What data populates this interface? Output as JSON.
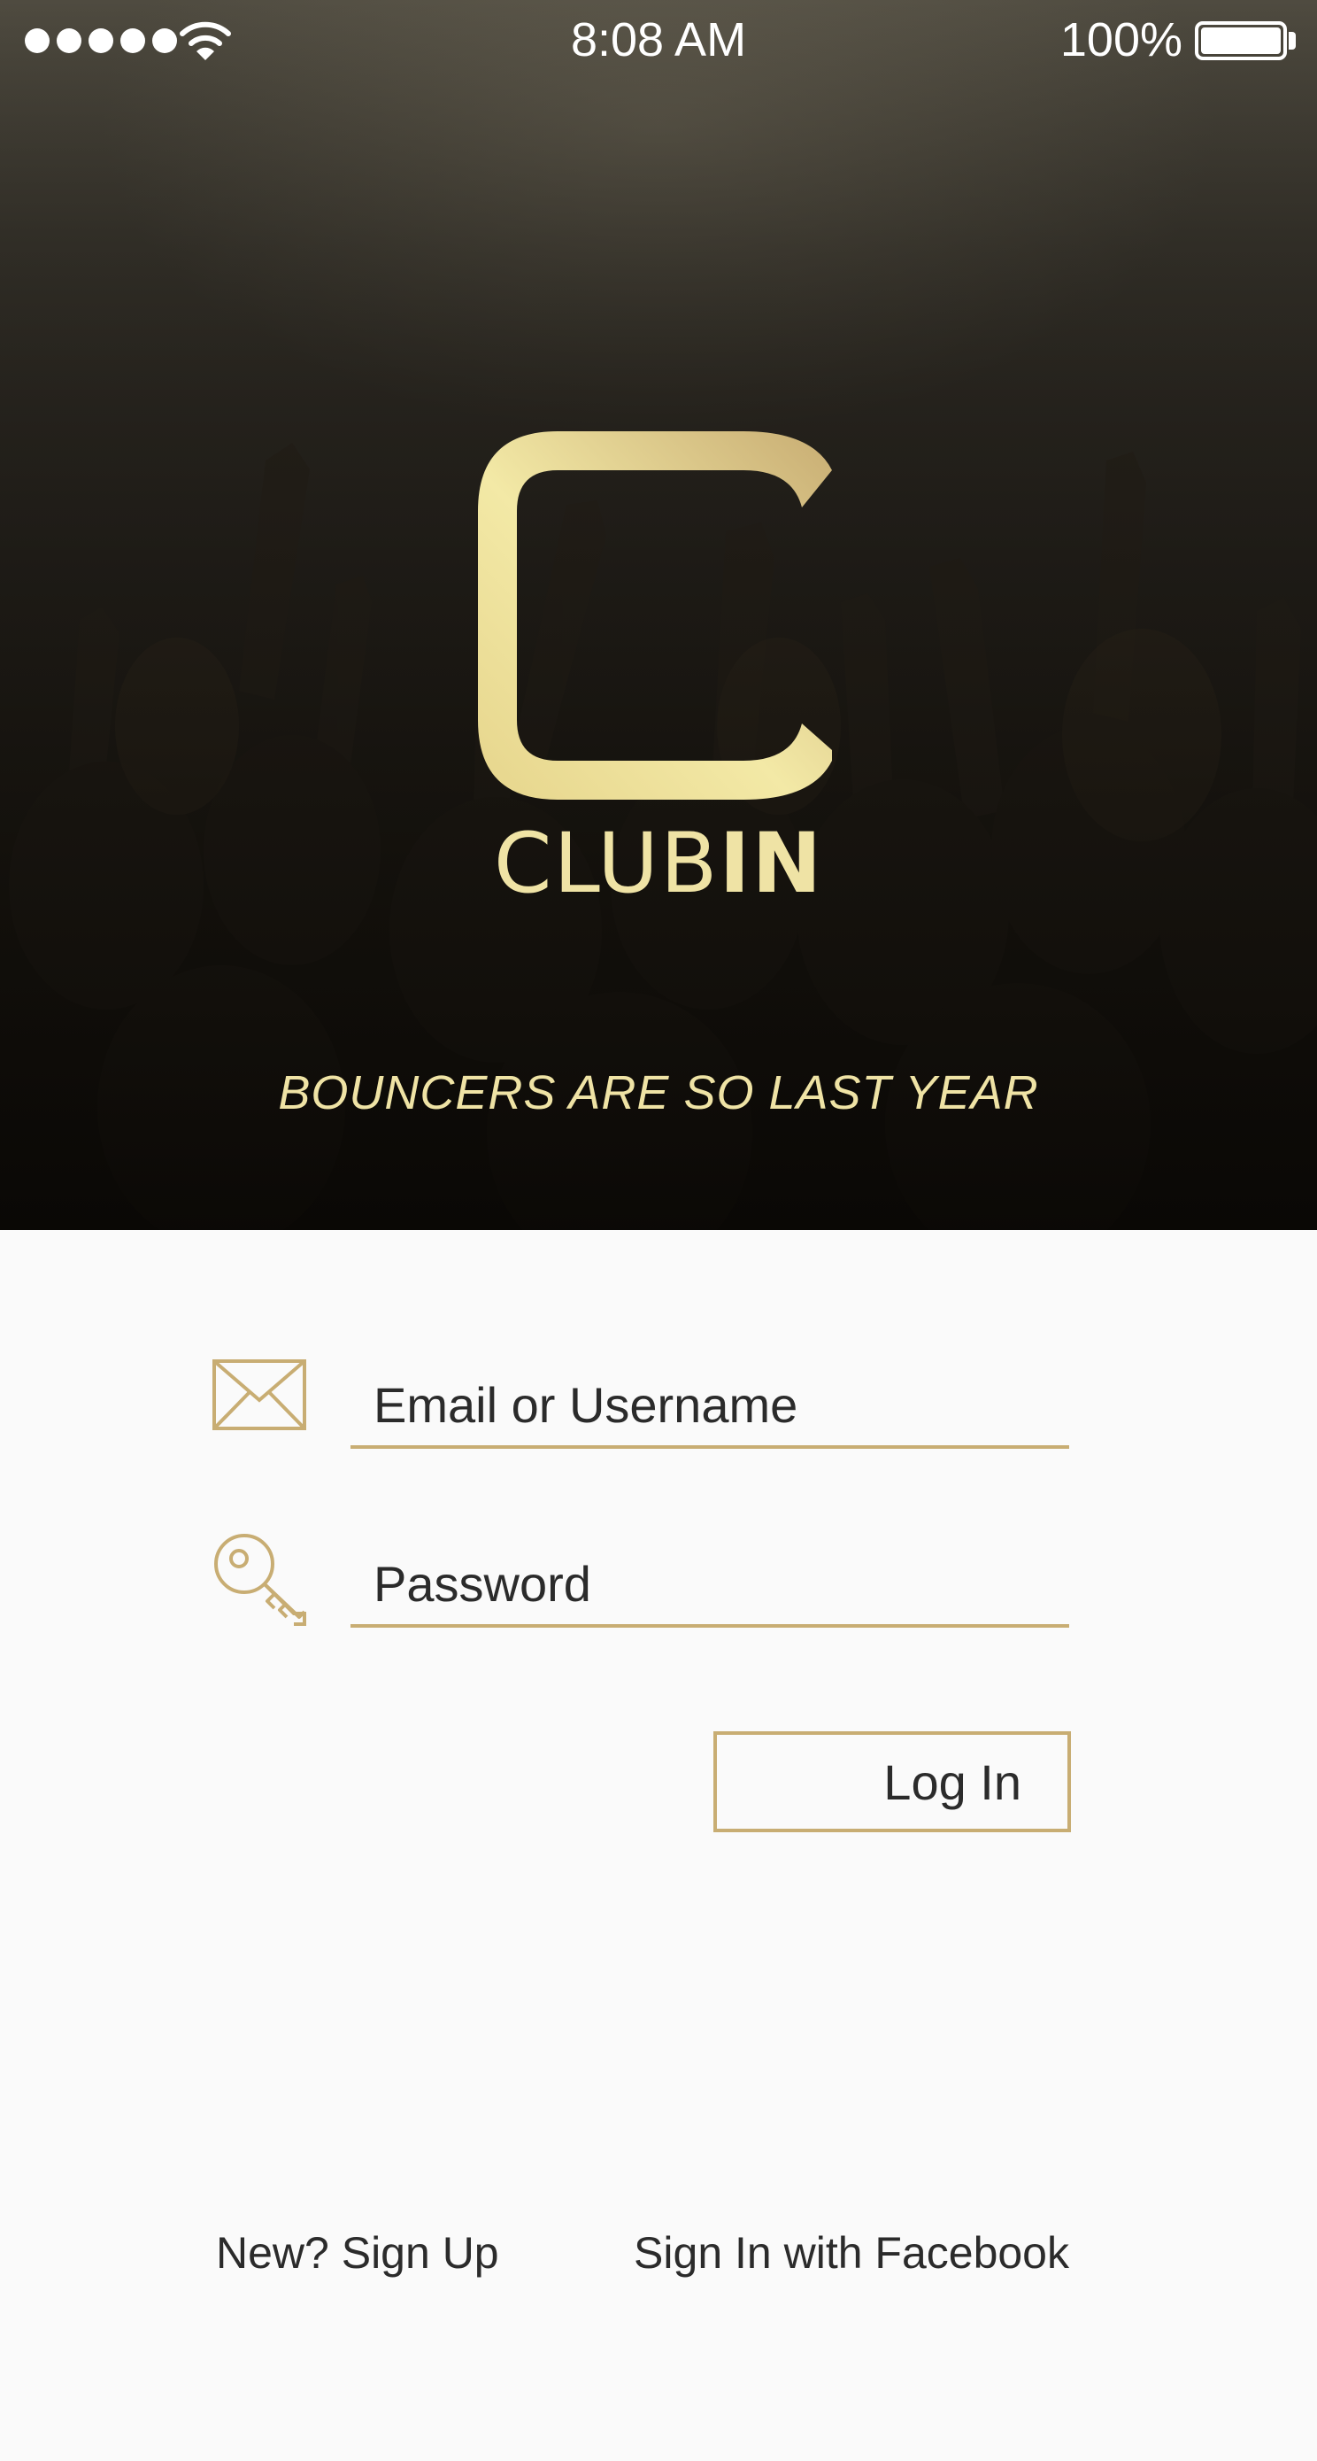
{
  "status_bar": {
    "time": "8:08 AM",
    "battery": "100%",
    "signal_dots": 5,
    "icons": [
      "signal-dots-icon",
      "wifi-icon",
      "battery-icon"
    ]
  },
  "hero": {
    "logo_icon": "clubin-c-logo-icon",
    "brand_light": "CLUB",
    "brand_bold": "IN",
    "tagline": "BOUNCERS ARE SO LAST YEAR",
    "logo_colors": [
      "#c8ad73",
      "#f3e9a6"
    ]
  },
  "form": {
    "email_icon": "envelope-icon",
    "email_placeholder": "Email or Username",
    "password_icon": "key-icon",
    "password_placeholder": "Password",
    "login_label": "Log In"
  },
  "footer": {
    "signup_label": "New? Sign Up",
    "facebook_label": "Sign In with Facebook"
  },
  "colors": {
    "accent": "#c8ad73",
    "logo_text": "#efe3a5",
    "page_bg": "#fafafa",
    "text": "#2b2b2b"
  }
}
